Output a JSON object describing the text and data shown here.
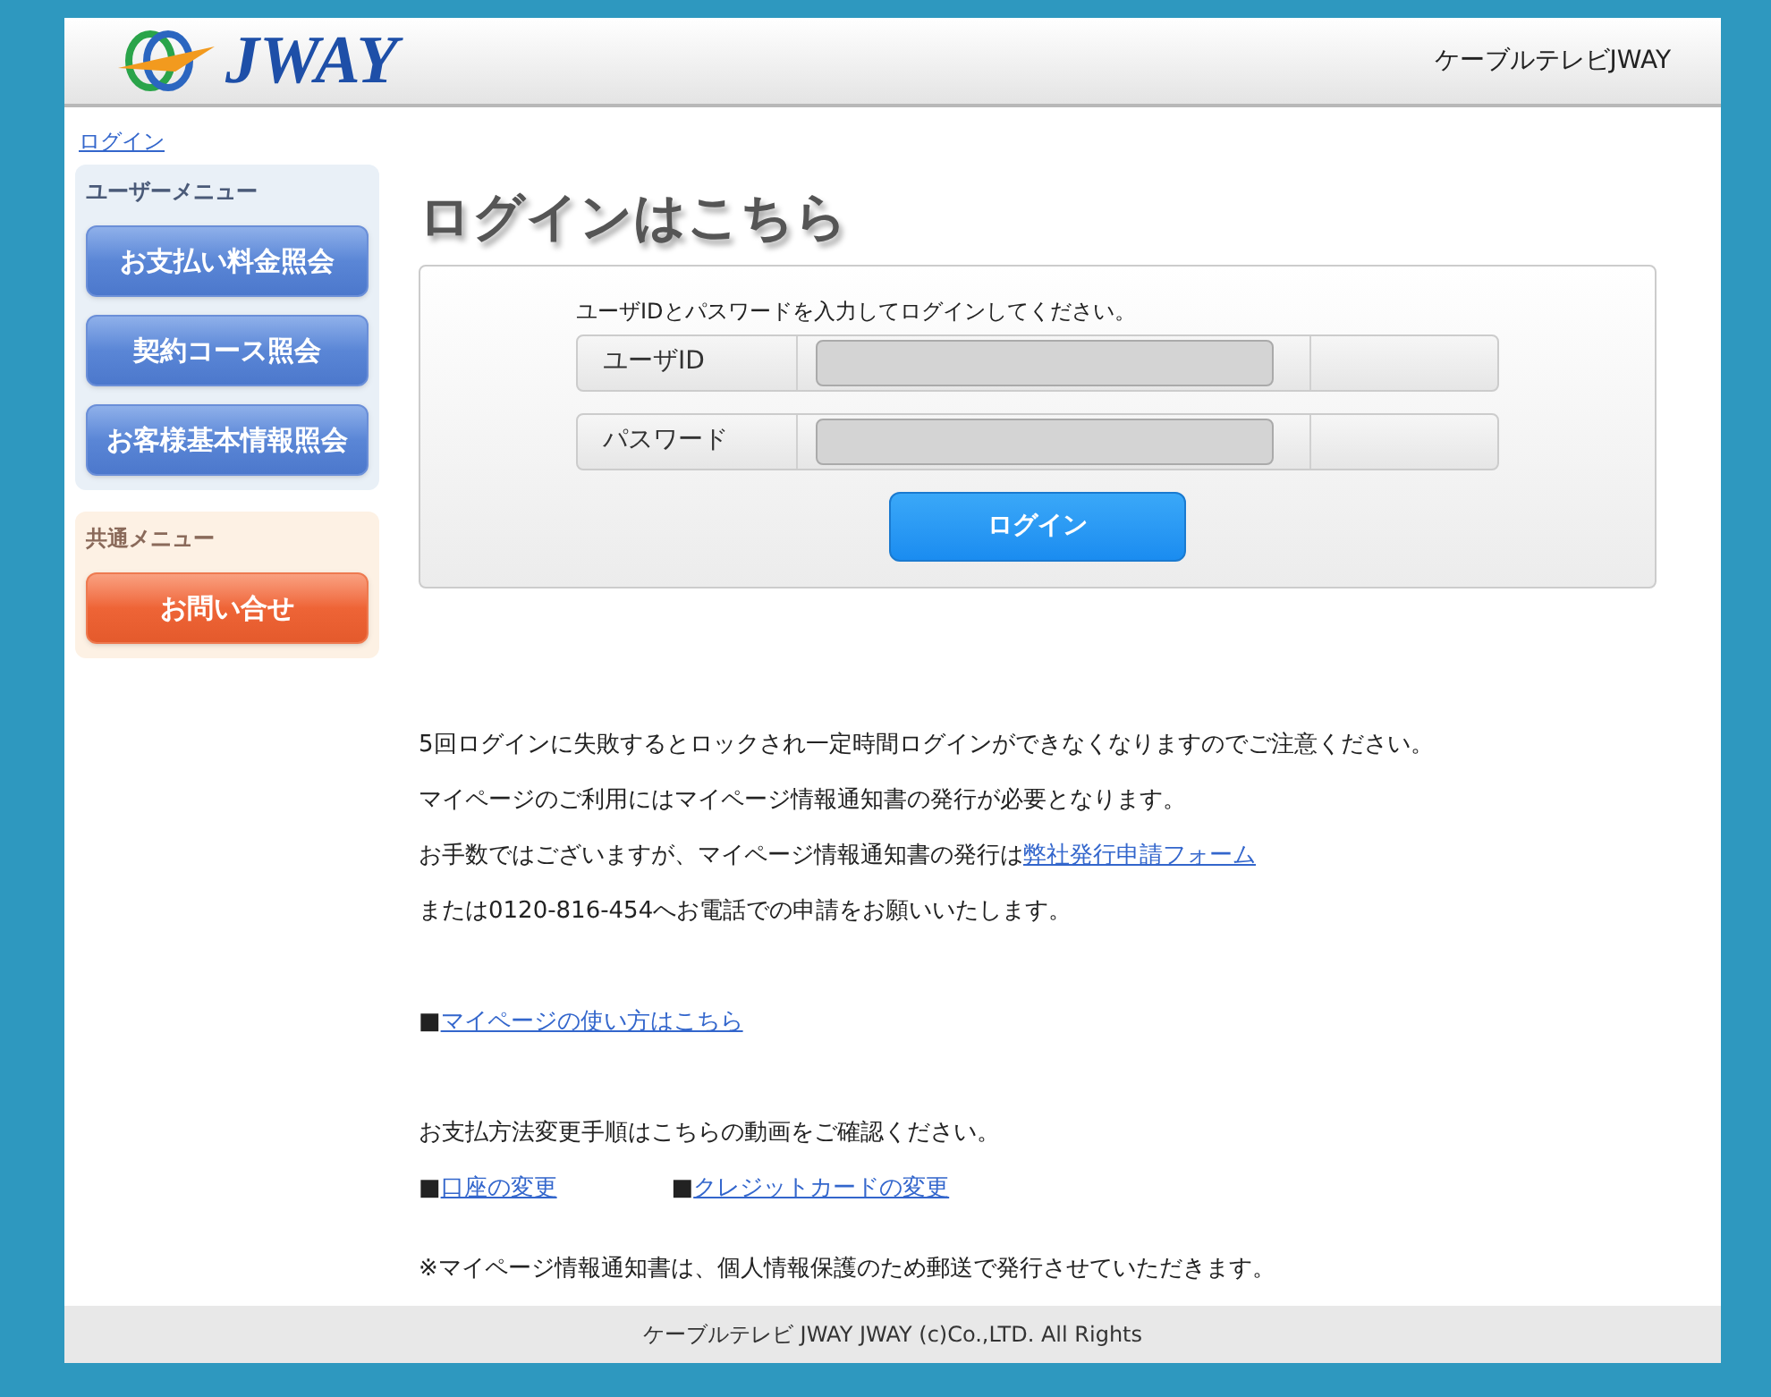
{
  "header": {
    "logo_text": "JWAY",
    "site_name": "ケーブルテレビJWAY"
  },
  "breadcrumb": "ログイン",
  "sidebar": {
    "menus": [
      {
        "kind": "user",
        "title": "ユーザーメニュー",
        "items": [
          "お支払い料金照会",
          "契約コース照会",
          "お客様基本情報照会"
        ]
      },
      {
        "kind": "common",
        "title": "共通メニュー",
        "items": [
          "お問い合せ"
        ]
      }
    ]
  },
  "login": {
    "title": "ログインはこちら",
    "instruction": "ユーザIDとパスワードを入力してログインしてください。",
    "fields": [
      {
        "label": "ユーザID"
      },
      {
        "label": "パスワード"
      }
    ],
    "button": "ログイン"
  },
  "notices": [
    {
      "text": "5回ログインに失敗するとロックされ一定時間ログインができなくなりますのでご注意ください。"
    },
    {
      "text": "マイページのご利用にはマイページ情報通知書の発行が必要となります。"
    },
    {
      "text": "お手数ではございますが、マイページ情報通知書の発行は",
      "link": "弊社発行申請フォーム"
    },
    {
      "text": "または0120-816-454へお電話での申請をお願いいたします。"
    }
  ],
  "guide_link": {
    "bullet": "■",
    "label": "マイページの使い方はこちら"
  },
  "payment": {
    "text": "お支払方法変更手順はこちらの動画をご確認ください。",
    "links": [
      {
        "bullet": "■",
        "label": "口座の変更"
      },
      {
        "bullet": "■",
        "label": "クレジットカードの変更"
      }
    ]
  },
  "note": "※マイページ情報通知書は、個人情報保護のため郵送で発行させていただきます。",
  "footer": "ケーブルテレビ JWAY JWAY (c)Co.,LTD. All Rights"
}
